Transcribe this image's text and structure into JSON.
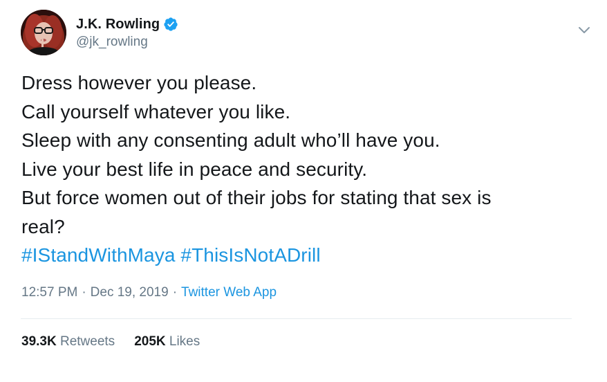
{
  "author": {
    "display_name": "J.K. Rowling",
    "handle": "@jk_rowling",
    "verified": true
  },
  "tweet": {
    "lines": [
      "Dress however you please.",
      "Call yourself whatever you like.",
      "Sleep with any consenting adult who’ll have you.",
      "Live your best life in peace and security.",
      "But force women out of their jobs for stating that sex is",
      "real?"
    ],
    "hashtags": [
      "#IStandWithMaya",
      "#ThisIsNotADrill"
    ]
  },
  "meta": {
    "time": "12:57 PM",
    "separator": "·",
    "date": "Dec 19, 2019",
    "source": "Twitter Web App"
  },
  "stats": {
    "retweets_count": "39.3K",
    "retweets_label": "Retweets",
    "likes_count": "205K",
    "likes_label": "Likes"
  },
  "icons": {
    "verified": "verified-badge-icon",
    "more": "chevron-down-icon"
  },
  "colors": {
    "link": "#1b95e0",
    "secondary_text": "#657786",
    "primary_text": "#14171a",
    "divider": "#e6ecf0"
  }
}
